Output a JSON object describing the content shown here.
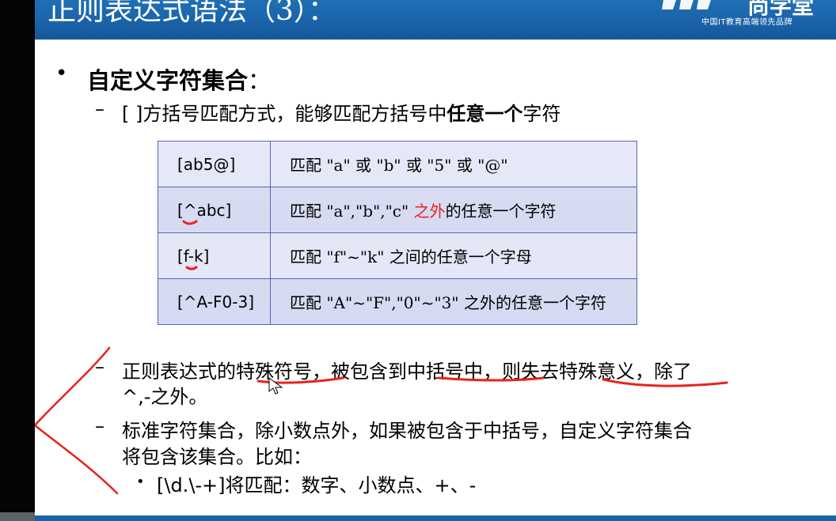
{
  "header": {
    "title": "正则表达式语法（3）：",
    "logo_text": "尚学堂",
    "logo_slogan": "中国IT教育高端领先品牌"
  },
  "bullet1": {
    "title": "自定义字符集合",
    "colon": "："
  },
  "sub1": {
    "part1": "[ ]方括号匹配方式，能够匹配方括号中",
    "bold": "任意一个",
    "part2": "字符"
  },
  "table": {
    "rows": [
      {
        "pattern": "[ab5@]",
        "desc_a": "匹配 \"a\" 或 \"b\" 或 \"5\" 或 \"@\"",
        "desc_red": "",
        "desc_b": ""
      },
      {
        "pattern": "[^abc]",
        "desc_a": "匹配 \"a\",\"b\",\"c\" ",
        "desc_red": "之外",
        "desc_b": "的任意一个字符"
      },
      {
        "pattern": "[f-k]",
        "desc_a": "匹配 \"f\"~\"k\" 之间的任意一个字母",
        "desc_red": "",
        "desc_b": ""
      },
      {
        "pattern": "[^A-F0-3]",
        "desc_a": "匹配 \"A\"~\"F\",\"0\"~\"3\" 之外的任意一个字符",
        "desc_red": "",
        "desc_b": ""
      }
    ]
  },
  "sub2": {
    "line1": "正则表达式的特殊符号，被包含到中括号中，则失去特殊意义，除了",
    "line2": "^,-之外。"
  },
  "sub3": {
    "line1": "标准字符集合，除小数点外，如果被包含于中括号，自定义字符集合",
    "line2": "将包含该集合。比如："
  },
  "subbullet": {
    "text": "[\\d.\\-+]将匹配：数字、小数点、+、-"
  },
  "colors": {
    "header_blue": "#1a62a8",
    "annotation_red": "#e8231d",
    "table_border": "#5a64b0"
  }
}
